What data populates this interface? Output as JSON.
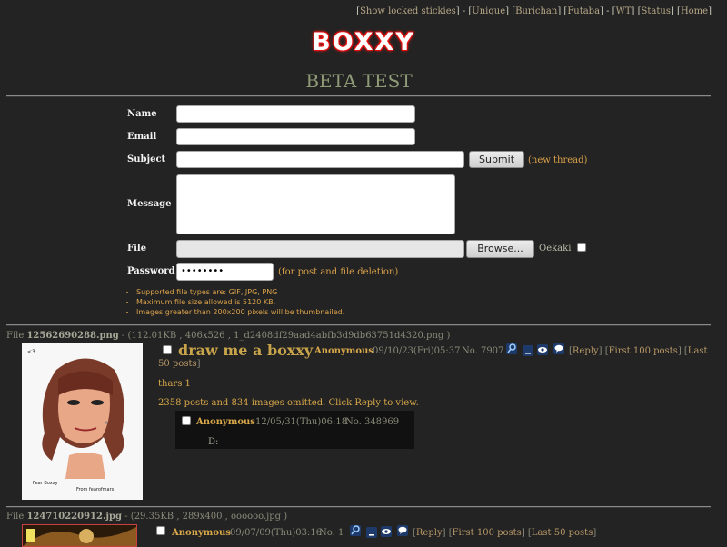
{
  "nav": {
    "items": [
      "Show locked stickies",
      "Unique",
      "Burichan",
      "Futaba",
      "WT",
      "Status",
      "Home"
    ]
  },
  "logo": {
    "text": "BOXXY"
  },
  "board": {
    "title": "BETA TEST"
  },
  "form": {
    "name_label": "Name",
    "email_label": "Email",
    "subject_label": "Subject",
    "submit_label": "Submit",
    "new_thread_note": "(new thread)",
    "message_label": "Message",
    "file_label": "File",
    "browse_label": "Browse...",
    "oekaki_label": "Oekaki",
    "password_label": "Password",
    "password_value": "••••••••",
    "password_note": "(for post and file deletion)",
    "rules": [
      "Supported file types are: GIF, JPG, PNG",
      "Maximum file size allowed is 5120 KB.",
      "Images greater than 200x200 pixels will be thumbnailed."
    ]
  },
  "threads": [
    {
      "file_prefix": "File",
      "file_name": "12562690288.png",
      "file_info": "- (112.01KB , 406x526 , 1_d2408df29aad4abfb3d9db63751d4320.png )",
      "thumb_caption_1": "Fear Boxxy",
      "thumb_caption_2": "From fearofmars",
      "thumb_mark": "<3",
      "subject": "draw me a boxxy",
      "name": "Anonymous",
      "date": "09/10/23(Fri)05:37",
      "number": "No. 7907",
      "reply_link": "Reply",
      "first100_link": "First 100 posts",
      "last50_link_a": "Last",
      "last50_link_b": "50 posts",
      "message": "thars 1",
      "omitted": "2358 posts and 834 images omitted. Click Reply to view.",
      "reply_post": {
        "name": "Anonymous",
        "date": "12/05/31(Thu)06:18",
        "number": "No. 348969",
        "message": "D:"
      }
    },
    {
      "file_prefix": "File",
      "file_name": "124710220912.jpg",
      "file_info": "- (29.35KB , 289x400 , oooooo.jpg )",
      "name": "Anonymous",
      "date": "09/07/09(Thu)03:16",
      "number": "No. 1",
      "reply_link": "Reply",
      "first100_link": "First 100 posts",
      "last50_link": "Last 50 posts"
    }
  ],
  "colors": {
    "background": "#232323",
    "accent_name": "#d8a84a",
    "board_title": "#8d9a75",
    "logo_glow": "#ff2020"
  }
}
